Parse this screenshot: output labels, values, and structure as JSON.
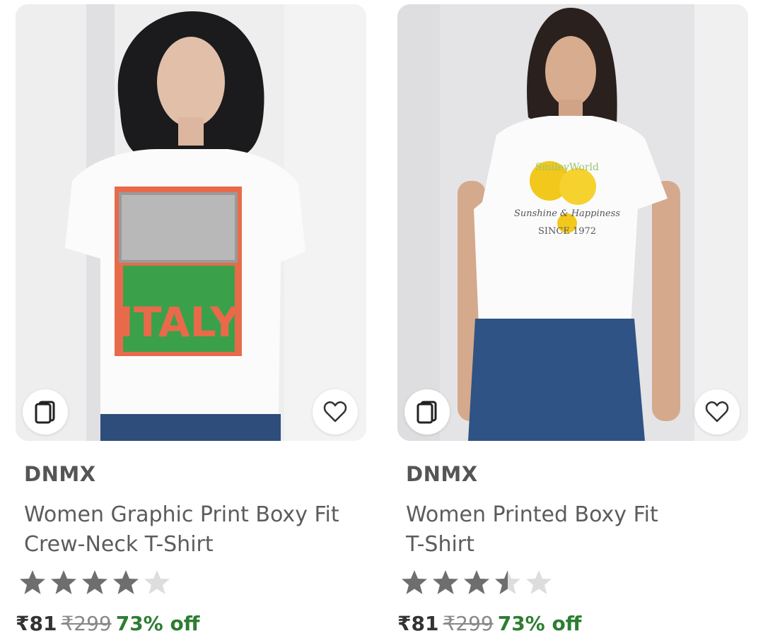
{
  "colors": {
    "star_filled": "#6e6e6e",
    "star_empty": "#dddddd",
    "discount": "#2e7d32",
    "brand_text": "#555555"
  },
  "products": [
    {
      "brand": "DNMX",
      "title_lines": [
        "Women Graphic Print Boxy Fit",
        "Crew-Neck T-Shirt"
      ],
      "shirt_print_text": "ITALY",
      "rating": 4,
      "price": "₹81",
      "mrp": "₹299",
      "discount": "73% off",
      "icons": [
        "similar-products-icon",
        "heart-icon"
      ]
    },
    {
      "brand": "DNMX",
      "title_lines": [
        "Women Printed Boxy Fit",
        "T-Shirt"
      ],
      "shirt_print_text": "SmileyWorld Sunshine & Happiness SINCE 1972",
      "rating": 3.5,
      "price": "₹81",
      "mrp": "₹299",
      "discount": "73% off",
      "icons": [
        "similar-products-icon",
        "heart-icon"
      ]
    }
  ]
}
